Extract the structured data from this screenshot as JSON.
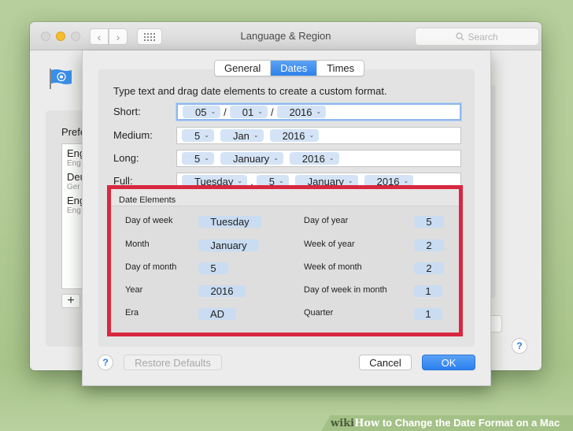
{
  "window": {
    "title": "Language & Region",
    "search_placeholder": "Search",
    "nav_back": "‹",
    "nav_forward": "›"
  },
  "preferred": {
    "title_partial": "Prefe",
    "languages": [
      {
        "name": "Eng",
        "sub": "Eng"
      },
      {
        "name": "Deu",
        "sub": "Ger"
      },
      {
        "name": "Eng",
        "sub": "Eng"
      }
    ],
    "add_label": "+"
  },
  "sheet": {
    "tabs": [
      {
        "label": "General",
        "active": false
      },
      {
        "label": "Dates",
        "active": true
      },
      {
        "label": "Times",
        "active": false
      }
    ],
    "instruction": "Type text and drag date elements to create a custom format.",
    "formats": [
      {
        "label": "Short:",
        "tokens": [
          "05",
          "/",
          "01",
          "/",
          "2016"
        ]
      },
      {
        "label": "Medium:",
        "tokens": [
          "5",
          "Jan",
          "2016"
        ]
      },
      {
        "label": "Long:",
        "tokens": [
          "5",
          "January",
          "2016"
        ]
      },
      {
        "label": "Full:",
        "tokens": [
          "Tuesday",
          ",",
          "5",
          "January",
          "2016"
        ]
      }
    ],
    "date_elements": {
      "title": "Date Elements",
      "left": [
        {
          "label": "Day of week",
          "value": "Tuesday"
        },
        {
          "label": "Month",
          "value": "January"
        },
        {
          "label": "Day of month",
          "value": "5"
        },
        {
          "label": "Year",
          "value": "2016"
        },
        {
          "label": "Era",
          "value": "AD"
        }
      ],
      "right": [
        {
          "label": "Day of year",
          "value": "5"
        },
        {
          "label": "Week of year",
          "value": "2"
        },
        {
          "label": "Week of month",
          "value": "2"
        },
        {
          "label": "Day of week in month",
          "value": "1"
        },
        {
          "label": "Quarter",
          "value": "1"
        }
      ]
    },
    "help_label": "?",
    "restore_label": "Restore Defaults",
    "cancel_label": "Cancel",
    "ok_label": "OK"
  },
  "banner": {
    "wiki": "wiki",
    "how": "How",
    "text": " to Change the Date Format on a Mac"
  },
  "colors": {
    "accent": "#2f81ea",
    "highlight": "#d8283f",
    "token_bg": "#d4e3f5"
  }
}
